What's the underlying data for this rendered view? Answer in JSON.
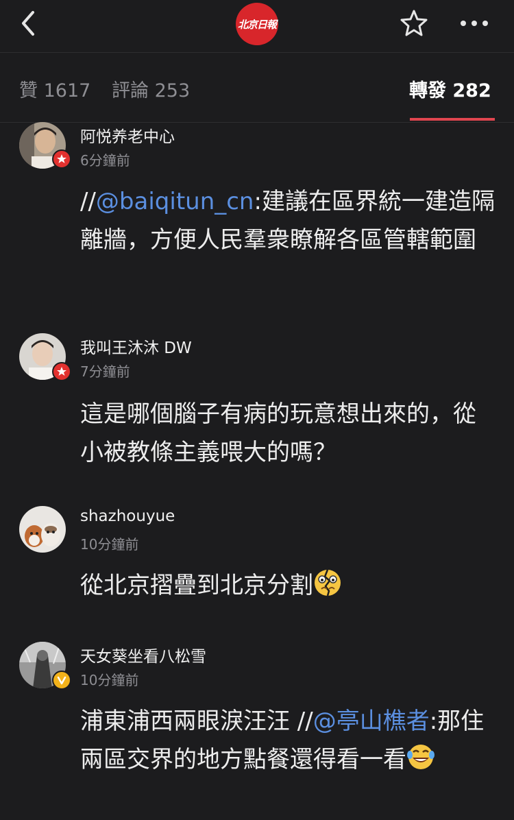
{
  "topbar": {
    "logo_text": "北京日報"
  },
  "tabs": [
    {
      "label": "贊 1617"
    },
    {
      "label": "評論 253"
    },
    {
      "label": "轉發 282"
    }
  ],
  "comments": [
    {
      "user": "阿悦养老中心",
      "time": "6分鐘前",
      "badge": "red-star",
      "prefix": "//",
      "mention": "@baiqitun_cn",
      "text": ":建議在區界統一建造隔離牆，方便人民羣衆瞭解各區管轄範圍"
    },
    {
      "user": "我叫王沐沐 DW",
      "time": "7分鐘前",
      "badge": "red-star",
      "text": "這是哪個腦子有病的玩意想出來的，從小被教條主義喂大的嗎？"
    },
    {
      "user": "shazhouyue",
      "time": "10分鐘前",
      "text": "從北京摺疊到北京分割",
      "emoji": "broken-face-emoji"
    },
    {
      "user": "天女葵坐看八松雪",
      "time": "10分鐘前",
      "badge": "gold-v",
      "text": "浦東浦西兩眼淚汪汪 //",
      "mention": "@亭山樵者",
      "text2": ":那住兩區交界的地方點餐還得看一看",
      "emoji": "laugh-cry-emoji"
    }
  ],
  "colors": {
    "background": "#1c1c1e",
    "accent": "#e0454f",
    "link": "#5b8fe0",
    "logo": "#d8262b"
  }
}
